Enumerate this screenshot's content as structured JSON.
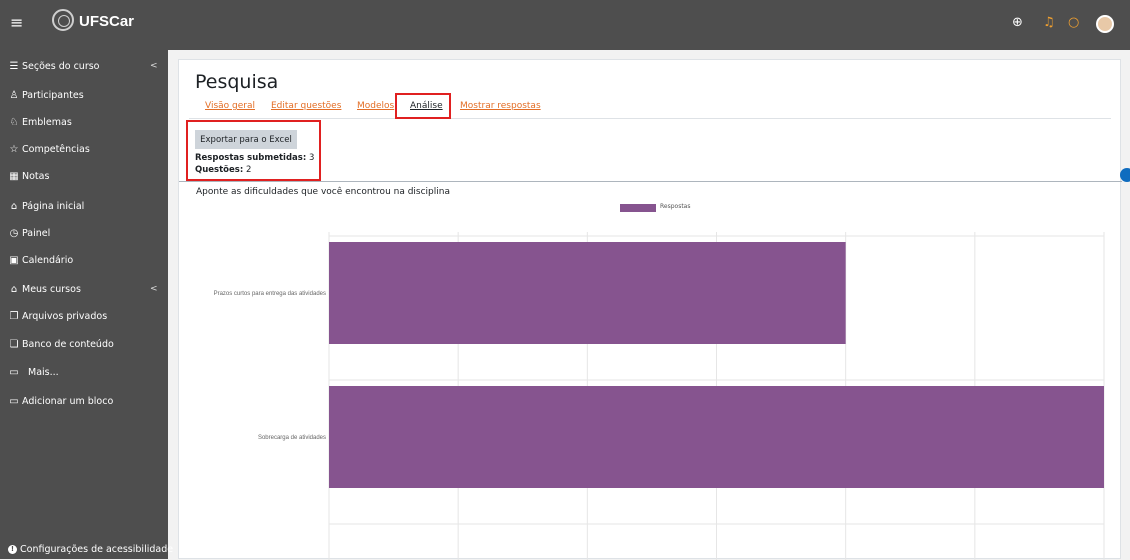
{
  "navbar": {
    "brand": "UFSCar",
    "icons": [
      "menu-icon",
      "globe-icon",
      "bell-icon",
      "chat-icon",
      "avatar"
    ]
  },
  "drawer": {
    "items": [
      {
        "label": "Seções do curso",
        "icon": "list-icon",
        "chevron": "<"
      },
      {
        "label": "Participantes",
        "icon": "users-icon"
      },
      {
        "label": "Emblemas",
        "icon": "badge-icon"
      },
      {
        "label": "Competências",
        "icon": "star-icon"
      },
      {
        "label": "Notas",
        "icon": "grades-icon"
      },
      {
        "label": "Página inicial",
        "icon": "home-icon"
      },
      {
        "label": "Painel",
        "icon": "dashboard-icon"
      },
      {
        "label": "Calendário",
        "icon": "calendar-icon"
      },
      {
        "label": "Meus cursos",
        "icon": "graduation-icon",
        "chevron": "<"
      },
      {
        "label": "Arquivos privados",
        "icon": "files-icon"
      },
      {
        "label": "Banco de conteúdo",
        "icon": "content-bank-icon"
      },
      {
        "label": "Mais...",
        "icon": "folder-icon"
      },
      {
        "label": "Adicionar um bloco",
        "icon": "folder-plus-icon"
      }
    ],
    "accessibility": "Configurações de acessibilidade"
  },
  "page": {
    "title": "Pesquisa",
    "tabs": [
      {
        "label": "Visão geral",
        "active": false
      },
      {
        "label": "Editar questões",
        "active": false
      },
      {
        "label": "Modelos",
        "active": false
      },
      {
        "label": "Análise",
        "active": true
      },
      {
        "label": "Mostrar respostas",
        "active": false
      }
    ],
    "export_button": "Exportar para o Excel",
    "responses_label": "Respostas submetidas:",
    "responses_value": "3",
    "questions_label": "Questões:",
    "questions_value": "2",
    "question_text": "Aponte as dificuldades que você encontrou na disciplina"
  },
  "colors": {
    "accent_link": "#e36e26",
    "bar": "#86548f",
    "highlight": "#e02020",
    "sidebar": "#4e4e4e"
  },
  "chart_data": {
    "type": "bar",
    "orientation": "horizontal",
    "categories": [
      "Prazos curtos para entrega das atividades",
      "Sobrecarga de atividades"
    ],
    "series": [
      {
        "name": "Respostas",
        "values": [
          2,
          3
        ]
      }
    ],
    "xlim": [
      0,
      3
    ],
    "legend": "top-center",
    "grid": true
  }
}
